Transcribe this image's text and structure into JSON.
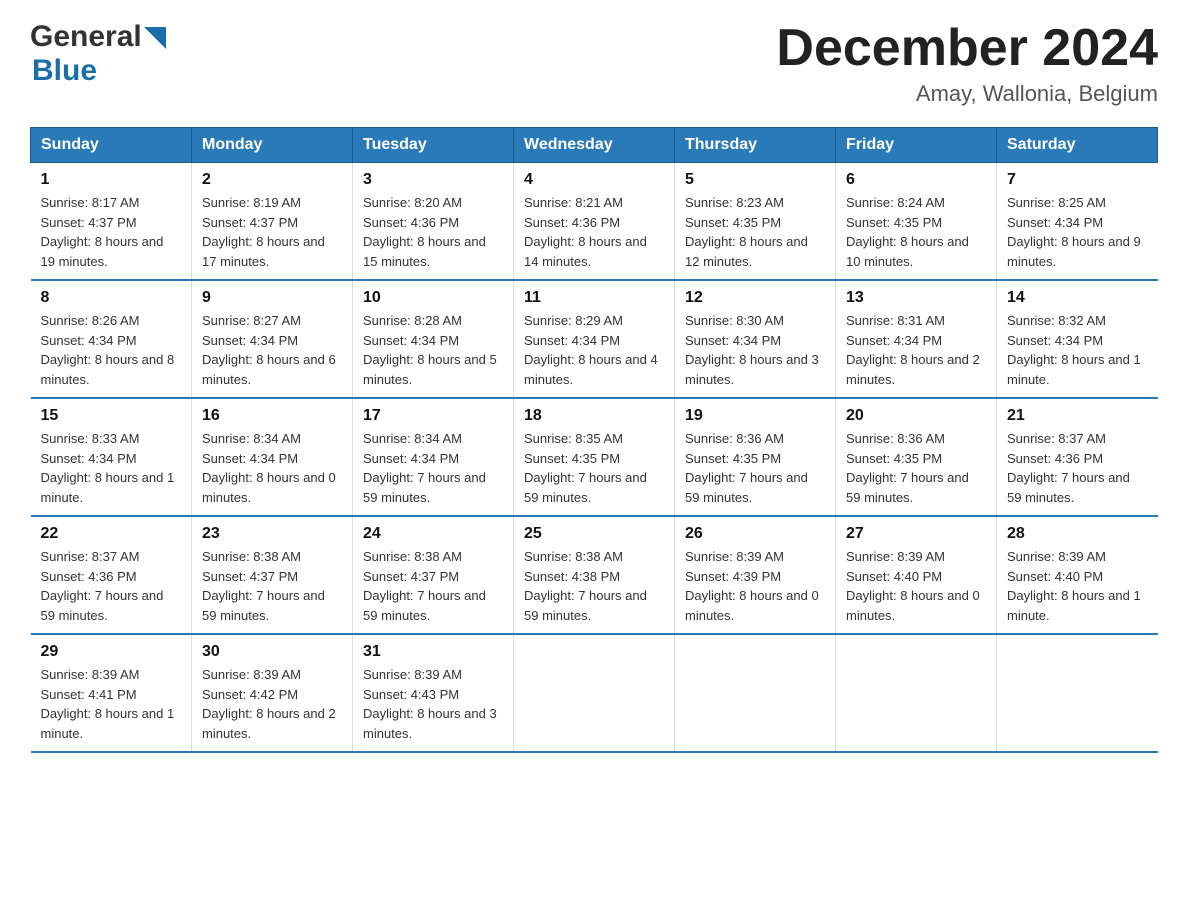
{
  "header": {
    "logo_general": "General",
    "logo_blue": "Blue",
    "month_title": "December 2024",
    "subtitle": "Amay, Wallonia, Belgium"
  },
  "days_of_week": [
    "Sunday",
    "Monday",
    "Tuesday",
    "Wednesday",
    "Thursday",
    "Friday",
    "Saturday"
  ],
  "weeks": [
    [
      {
        "day": "1",
        "sunrise": "8:17 AM",
        "sunset": "4:37 PM",
        "daylight": "8 hours and 19 minutes."
      },
      {
        "day": "2",
        "sunrise": "8:19 AM",
        "sunset": "4:37 PM",
        "daylight": "8 hours and 17 minutes."
      },
      {
        "day": "3",
        "sunrise": "8:20 AM",
        "sunset": "4:36 PM",
        "daylight": "8 hours and 15 minutes."
      },
      {
        "day": "4",
        "sunrise": "8:21 AM",
        "sunset": "4:36 PM",
        "daylight": "8 hours and 14 minutes."
      },
      {
        "day": "5",
        "sunrise": "8:23 AM",
        "sunset": "4:35 PM",
        "daylight": "8 hours and 12 minutes."
      },
      {
        "day": "6",
        "sunrise": "8:24 AM",
        "sunset": "4:35 PM",
        "daylight": "8 hours and 10 minutes."
      },
      {
        "day": "7",
        "sunrise": "8:25 AM",
        "sunset": "4:34 PM",
        "daylight": "8 hours and 9 minutes."
      }
    ],
    [
      {
        "day": "8",
        "sunrise": "8:26 AM",
        "sunset": "4:34 PM",
        "daylight": "8 hours and 8 minutes."
      },
      {
        "day": "9",
        "sunrise": "8:27 AM",
        "sunset": "4:34 PM",
        "daylight": "8 hours and 6 minutes."
      },
      {
        "day": "10",
        "sunrise": "8:28 AM",
        "sunset": "4:34 PM",
        "daylight": "8 hours and 5 minutes."
      },
      {
        "day": "11",
        "sunrise": "8:29 AM",
        "sunset": "4:34 PM",
        "daylight": "8 hours and 4 minutes."
      },
      {
        "day": "12",
        "sunrise": "8:30 AM",
        "sunset": "4:34 PM",
        "daylight": "8 hours and 3 minutes."
      },
      {
        "day": "13",
        "sunrise": "8:31 AM",
        "sunset": "4:34 PM",
        "daylight": "8 hours and 2 minutes."
      },
      {
        "day": "14",
        "sunrise": "8:32 AM",
        "sunset": "4:34 PM",
        "daylight": "8 hours and 1 minute."
      }
    ],
    [
      {
        "day": "15",
        "sunrise": "8:33 AM",
        "sunset": "4:34 PM",
        "daylight": "8 hours and 1 minute."
      },
      {
        "day": "16",
        "sunrise": "8:34 AM",
        "sunset": "4:34 PM",
        "daylight": "8 hours and 0 minutes."
      },
      {
        "day": "17",
        "sunrise": "8:34 AM",
        "sunset": "4:34 PM",
        "daylight": "7 hours and 59 minutes."
      },
      {
        "day": "18",
        "sunrise": "8:35 AM",
        "sunset": "4:35 PM",
        "daylight": "7 hours and 59 minutes."
      },
      {
        "day": "19",
        "sunrise": "8:36 AM",
        "sunset": "4:35 PM",
        "daylight": "7 hours and 59 minutes."
      },
      {
        "day": "20",
        "sunrise": "8:36 AM",
        "sunset": "4:35 PM",
        "daylight": "7 hours and 59 minutes."
      },
      {
        "day": "21",
        "sunrise": "8:37 AM",
        "sunset": "4:36 PM",
        "daylight": "7 hours and 59 minutes."
      }
    ],
    [
      {
        "day": "22",
        "sunrise": "8:37 AM",
        "sunset": "4:36 PM",
        "daylight": "7 hours and 59 minutes."
      },
      {
        "day": "23",
        "sunrise": "8:38 AM",
        "sunset": "4:37 PM",
        "daylight": "7 hours and 59 minutes."
      },
      {
        "day": "24",
        "sunrise": "8:38 AM",
        "sunset": "4:37 PM",
        "daylight": "7 hours and 59 minutes."
      },
      {
        "day": "25",
        "sunrise": "8:38 AM",
        "sunset": "4:38 PM",
        "daylight": "7 hours and 59 minutes."
      },
      {
        "day": "26",
        "sunrise": "8:39 AM",
        "sunset": "4:39 PM",
        "daylight": "8 hours and 0 minutes."
      },
      {
        "day": "27",
        "sunrise": "8:39 AM",
        "sunset": "4:40 PM",
        "daylight": "8 hours and 0 minutes."
      },
      {
        "day": "28",
        "sunrise": "8:39 AM",
        "sunset": "4:40 PM",
        "daylight": "8 hours and 1 minute."
      }
    ],
    [
      {
        "day": "29",
        "sunrise": "8:39 AM",
        "sunset": "4:41 PM",
        "daylight": "8 hours and 1 minute."
      },
      {
        "day": "30",
        "sunrise": "8:39 AM",
        "sunset": "4:42 PM",
        "daylight": "8 hours and 2 minutes."
      },
      {
        "day": "31",
        "sunrise": "8:39 AM",
        "sunset": "4:43 PM",
        "daylight": "8 hours and 3 minutes."
      },
      null,
      null,
      null,
      null
    ]
  ],
  "labels": {
    "sunrise_prefix": "Sunrise: ",
    "sunset_prefix": "Sunset: ",
    "daylight_prefix": "Daylight: "
  }
}
